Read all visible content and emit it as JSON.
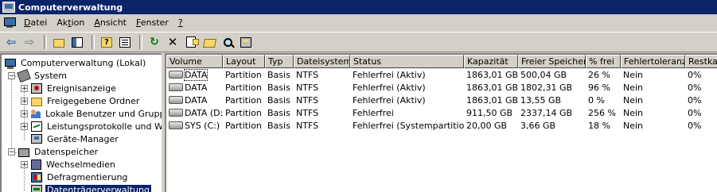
{
  "window": {
    "title": "Computerverwaltung"
  },
  "menu": {
    "items": [
      {
        "pre": "",
        "ul": "D",
        "post": "atei"
      },
      {
        "pre": "Ak",
        "ul": "t",
        "post": "ion"
      },
      {
        "pre": "",
        "ul": "A",
        "post": "nsicht"
      },
      {
        "pre": "",
        "ul": "F",
        "post": "enster"
      },
      {
        "pre": "",
        "ul": "?",
        "post": ""
      }
    ]
  },
  "toolbar": {
    "icons": [
      "back-arrow-icon",
      "forward-arrow-icon",
      "up-folder-icon",
      "show-hide-tree-icon",
      "help-icon",
      "properties-icon",
      "refresh-icon",
      "delete-icon",
      "settings-icon",
      "open-folder-icon",
      "search-icon",
      "disk-icon"
    ]
  },
  "tree": {
    "root": "Computerverwaltung (Lokal)",
    "system": "System",
    "event_viewer": "Ereignisanzeige",
    "shared_folders": "Freigegebene Ordner",
    "local_users": "Lokale Benutzer und Gruppe",
    "perf_logs": "Leistungsprotokolle und War",
    "device_manager": "Geräte-Manager",
    "storage": "Datenspeicher",
    "removable": "Wechselmedien",
    "defrag": "Defragmentierung",
    "disk_mgmt": "Datenträgerverwaltung"
  },
  "table": {
    "columns": [
      "Volume",
      "Layout",
      "Typ",
      "Dateisystem",
      "Status",
      "Kapazität",
      "Freier Speicher",
      "% frei",
      "Fehlertoleranz",
      "Restkap"
    ],
    "rows": [
      [
        "DATA",
        "Partition",
        "Basis",
        "NTFS",
        "Fehlerfrei (Aktiv)",
        "1863,01 GB",
        "500,04 GB",
        "26 %",
        "Nein",
        "0%"
      ],
      [
        "DATA",
        "Partition",
        "Basis",
        "NTFS",
        "Fehlerfrei (Aktiv)",
        "1863,01 GB",
        "1802,31 GB",
        "96 %",
        "Nein",
        "0%"
      ],
      [
        "DATA",
        "Partition",
        "Basis",
        "NTFS",
        "Fehlerfrei (Aktiv)",
        "1863,01 GB",
        "13,55 GB",
        "0 %",
        "Nein",
        "0%"
      ],
      [
        "DATA (D:)",
        "Partition",
        "Basis",
        "NTFS",
        "Fehlerfrei",
        "911,50 GB",
        "2337,14 GB",
        "256 %",
        "Nein",
        "0%"
      ],
      [
        "SYS (C:)",
        "Partition",
        "Basis",
        "NTFS",
        "Fehlerfrei (Systempartition)",
        "20,00 GB",
        "3,66 GB",
        "18 %",
        "Nein",
        "0%"
      ]
    ]
  },
  "colors": {
    "titlebar": "#0a246a",
    "selection": "#0a246a",
    "face": "#d4d0c8"
  }
}
